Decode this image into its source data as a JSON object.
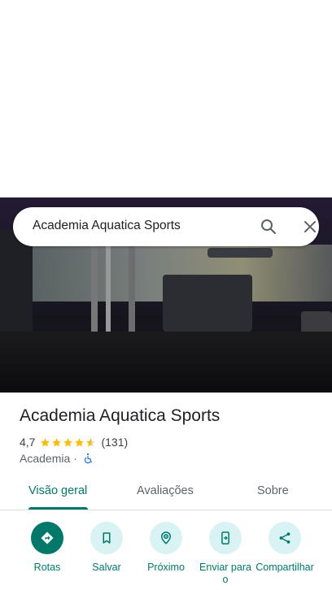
{
  "search": {
    "query": "Academia Aquatica Sports"
  },
  "place": {
    "name": "Academia Aquatica Sports",
    "rating": "4,7",
    "rating_value": 4.7,
    "review_count": "(131)",
    "category": "Academia",
    "separator": "·",
    "accessibility_icon": "wheelchair-icon"
  },
  "tabs": [
    {
      "label": "Visão geral",
      "active": true
    },
    {
      "label": "Avaliações",
      "active": false
    },
    {
      "label": "Sobre",
      "active": false
    }
  ],
  "actions": [
    {
      "label": "Rotas",
      "icon": "directions-icon"
    },
    {
      "label": "Salvar",
      "icon": "bookmark-icon"
    },
    {
      "label": "Próximo",
      "icon": "nearby-icon"
    },
    {
      "label": "Enviar para o",
      "icon": "send-to-phone-icon"
    },
    {
      "label": "Compartilhar",
      "icon": "share-icon"
    }
  ],
  "colors": {
    "accent": "#00796b",
    "action_bg": "#d9f2f4",
    "star": "#fbbc04",
    "accessibility": "#1a73e8"
  }
}
